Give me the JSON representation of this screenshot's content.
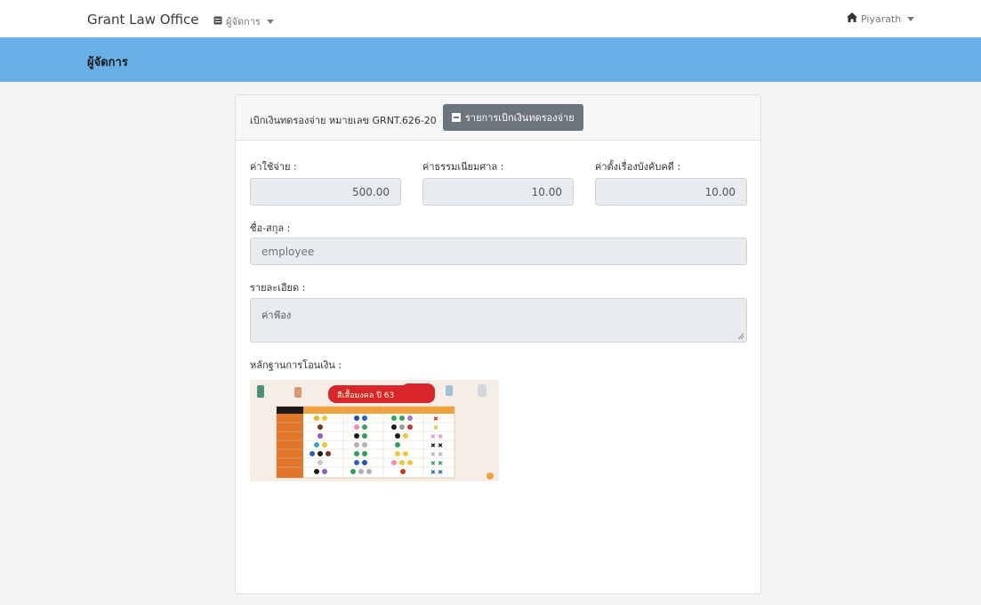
{
  "navbar": {
    "brand": "Grant Law Office",
    "menu_label": "ผู้จัดการ",
    "user_label": "Piyarath"
  },
  "titlebar": {
    "title": "ผู้จัดการ"
  },
  "card": {
    "header_text": "เบิกเงินทดรองจ่าย หมายเลข GRNT.626-20",
    "list_button_label": "รายการเบิกเงินทดรองจ่าย",
    "fields": {
      "expense_label": "ค่าใช้จ่าย :",
      "expense_value": "500.00",
      "court_fee_label": "ค่าธรรมเนียมศาล :",
      "court_fee_value": "10.00",
      "enforcement_label": "ค่าตั้งเรื่องบังคับคดี :",
      "enforcement_value": "10.00",
      "name_label": "ชื่อ-สกุล :",
      "name_value": "employee",
      "detail_label": "รายละเอียด :",
      "detail_value": "ค่าฟ้อง",
      "proof_label": "หลักฐานการโอนเงิน :"
    }
  },
  "proof_image": {
    "banner_text": "สีเสื้อมงคล ปี 63",
    "colors": {
      "banner": "#d9262b",
      "header_row": "#f0a23c",
      "row_label": "#e3752b"
    }
  },
  "icons": {
    "menu_icon": "list-icon",
    "user_icon": "home-icon",
    "button_icon": "list-icon"
  }
}
